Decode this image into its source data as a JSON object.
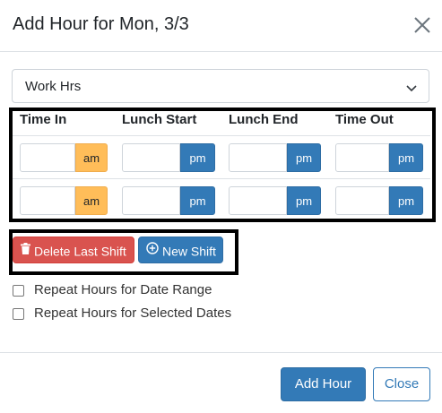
{
  "modal": {
    "title": "Add Hour for Mon, 3/3",
    "close_icon": "close-icon"
  },
  "hour_type": {
    "selected": "Work Hrs",
    "icon": "chevron-down-icon"
  },
  "table": {
    "headers": [
      "Time In",
      "Lunch Start",
      "Lunch End",
      "Time Out"
    ],
    "rows": [
      {
        "time_in": {
          "value": "",
          "period": "am"
        },
        "lunch_start": {
          "value": "",
          "period": "pm"
        },
        "lunch_end": {
          "value": "",
          "period": "pm"
        },
        "time_out": {
          "value": "",
          "period": "pm"
        }
      },
      {
        "time_in": {
          "value": "",
          "period": "am"
        },
        "lunch_start": {
          "value": "",
          "period": "pm"
        },
        "lunch_end": {
          "value": "",
          "period": "pm"
        },
        "time_out": {
          "value": "",
          "period": "pm"
        }
      }
    ]
  },
  "shift_buttons": {
    "delete_label": "Delete Last Shift",
    "delete_icon": "trash-icon",
    "new_label": "New Shift",
    "new_icon": "plus-circle-icon"
  },
  "options": {
    "repeat_range_label": "Repeat Hours for Date Range",
    "repeat_selected_label": "Repeat Hours for Selected Dates",
    "repeat_range_checked": false,
    "repeat_selected_checked": false
  },
  "footer": {
    "add_label": "Add Hour",
    "close_label": "Close"
  },
  "colors": {
    "primary": "#337ab7",
    "danger": "#d9534f",
    "am_badge": "#ffbd59"
  }
}
